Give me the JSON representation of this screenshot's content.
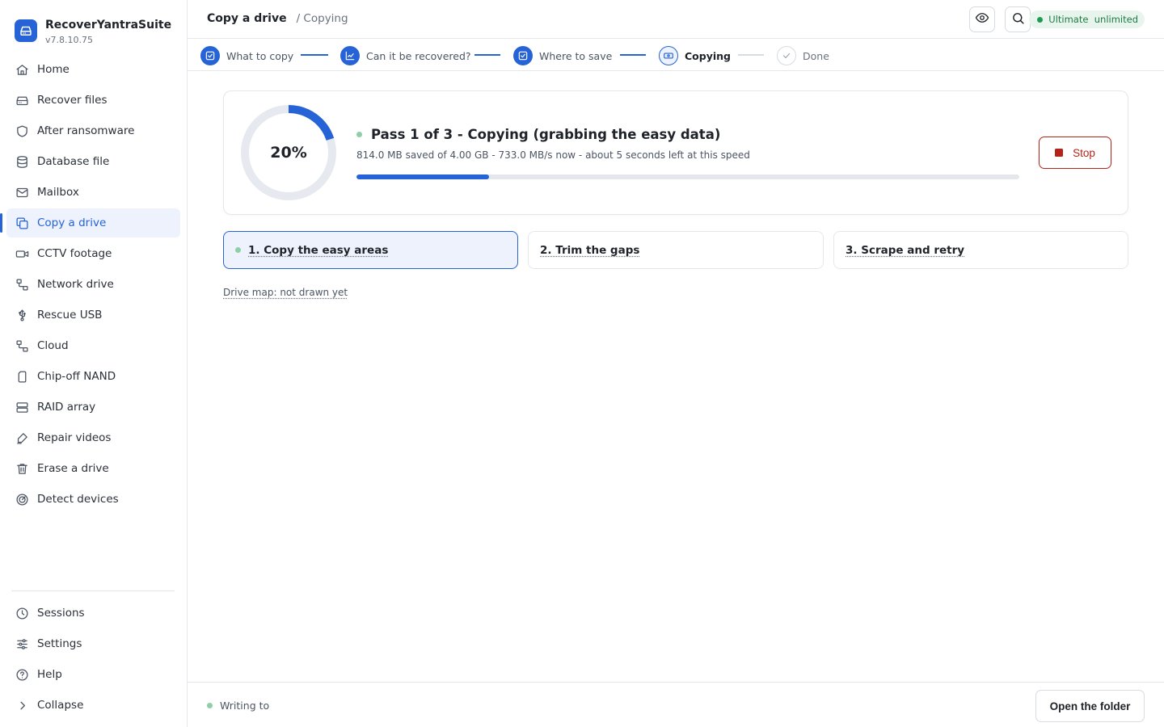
{
  "app": {
    "name": "RecoverYantraSuite",
    "version": "v7.8.10.75",
    "accent": "#2563d6"
  },
  "sidebar": {
    "items": [
      {
        "label": "Home",
        "icon": "home-icon"
      },
      {
        "label": "Recover files",
        "icon": "drive-icon"
      },
      {
        "label": "After ransomware",
        "icon": "shield-icon"
      },
      {
        "label": "Database file",
        "icon": "database-icon"
      },
      {
        "label": "Mailbox",
        "icon": "mail-icon"
      },
      {
        "label": "Copy a drive",
        "icon": "copy-icon",
        "active": true
      },
      {
        "label": "CCTV footage",
        "icon": "video-camera-icon"
      },
      {
        "label": "Network drive",
        "icon": "network-icon"
      },
      {
        "label": "Rescue USB",
        "icon": "usb-icon"
      },
      {
        "label": "Cloud",
        "icon": "cloud-network-icon"
      },
      {
        "label": "Chip-off NAND",
        "icon": "chip-icon"
      },
      {
        "label": "RAID array",
        "icon": "raid-icon"
      },
      {
        "label": "Repair videos",
        "icon": "brush-icon"
      },
      {
        "label": "Erase a drive",
        "icon": "trash-icon"
      },
      {
        "label": "Detect devices",
        "icon": "radar-icon"
      }
    ],
    "bottom_items": [
      {
        "label": "Sessions",
        "icon": "clock-icon"
      },
      {
        "label": "Settings",
        "icon": "sliders-icon"
      },
      {
        "label": "Help",
        "icon": "help-icon"
      },
      {
        "label": "Collapse",
        "icon": "chevron-right-icon"
      }
    ]
  },
  "header": {
    "title": "Copy a drive",
    "subtitle": "/ Copying",
    "license_badge": "Ultimate  unlimited",
    "license_color": "#1e9a52"
  },
  "stepper": {
    "steps": [
      {
        "label": "What to copy",
        "state": "done"
      },
      {
        "label": "Can it be recovered?",
        "state": "done"
      },
      {
        "label": "Where to save",
        "state": "done"
      },
      {
        "label": "Copying",
        "state": "current"
      },
      {
        "label": "Done",
        "state": "todo"
      }
    ]
  },
  "progress": {
    "percent_label": "20%",
    "fraction": 0.2,
    "title": "Pass 1 of 3 - Copying (grabbing the easy data)",
    "detail": "814.0 MB saved of 4.00 GB - 733.0 MB/s now - about 5 seconds left at this speed",
    "stop_label": "Stop",
    "stop_color": "#b42318"
  },
  "phases": [
    {
      "label": "1. Copy the easy areas",
      "active": true
    },
    {
      "label": "2. Trim the gaps",
      "active": false
    },
    {
      "label": "3. Scrape and retry",
      "active": false
    }
  ],
  "drive_map": "Drive map: not drawn yet",
  "footer": {
    "writing_label": "Writing to",
    "open_folder_label": "Open the folder"
  }
}
